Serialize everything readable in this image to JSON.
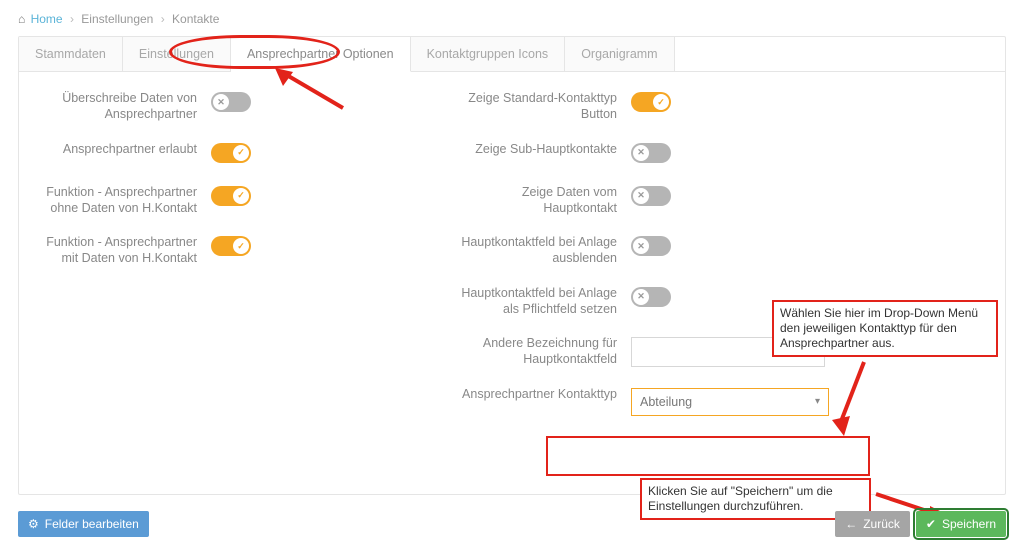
{
  "breadcrumb": {
    "home": "Home",
    "settings": "Einstellungen",
    "contacts": "Kontakte"
  },
  "tabs": {
    "stammdaten": "Stammdaten",
    "einstellungen": "Einstellungen",
    "ansprech": "Ansprechpartner Optionen",
    "icons": "Kontaktgruppen Icons",
    "organigramm": "Organigramm"
  },
  "left": {
    "overwrite": {
      "label": "Überschreibe Daten von Ansprechpartner",
      "on": false
    },
    "allowed": {
      "label": "Ansprechpartner erlaubt",
      "on": true
    },
    "func_without": {
      "label": "Funktion - Ansprechpartner ohne Daten von H.Kontakt",
      "on": true
    },
    "func_with": {
      "label": "Funktion - Ansprechpartner mit Daten von H.Kontakt",
      "on": true
    }
  },
  "right": {
    "std_button": {
      "label": "Zeige Standard-Kontakttyp Button",
      "on": true
    },
    "sub_main": {
      "label": "Zeige Sub-Hauptkontakte",
      "on": false
    },
    "main_data": {
      "label": "Zeige Daten vom Hauptkontakt",
      "on": false
    },
    "hide_main": {
      "label": "Hauptkontaktfeld bei Anlage ausblenden",
      "on": false
    },
    "req_main": {
      "label": "Hauptkontaktfeld bei Anlage als Pflichtfeld setzen",
      "on": false
    },
    "other_label": {
      "label": "Andere Bezeichnung für Hauptkontaktfeld",
      "value": ""
    },
    "ktyp": {
      "label": "Ansprechpartner Kontakttyp",
      "value": "Abteilung"
    }
  },
  "annotations": {
    "dropdown_hint": "Wählen Sie hier im Drop-Down Menü den jeweiligen Kontakttyp für den Ansprechpartner aus.",
    "save_hint": "Klicken Sie auf \"Speichern\" um die Einstellungen durchzuführen."
  },
  "footer": {
    "fields_edit": "Felder bearbeiten",
    "back": "Zurück",
    "save": "Speichern"
  }
}
